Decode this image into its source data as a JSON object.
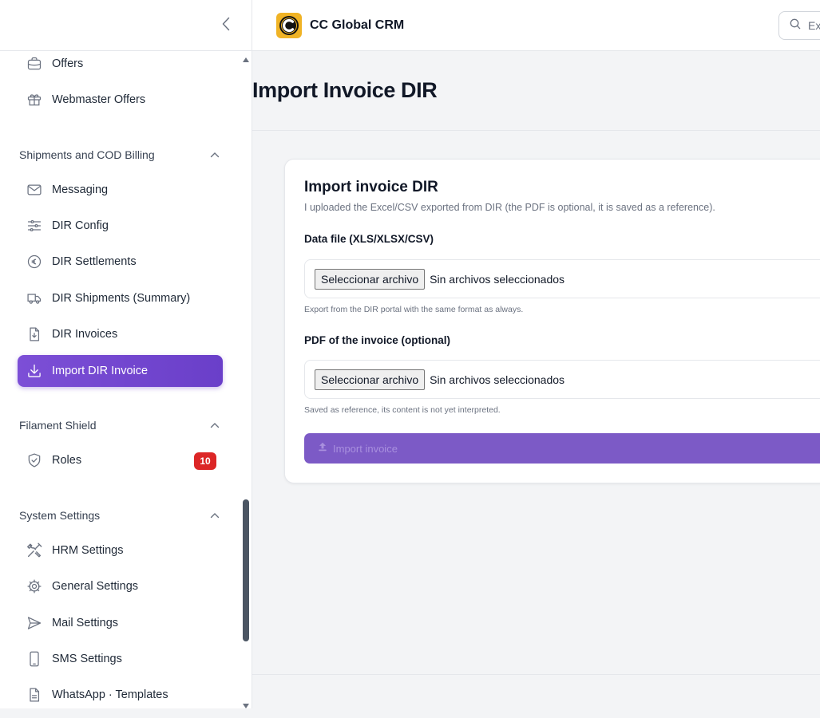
{
  "app": {
    "name": "CC Global CRM"
  },
  "search": {
    "placeholder": "Ex"
  },
  "sidebar": {
    "items_top": [
      {
        "label": "Offers",
        "icon": "briefcase-icon"
      },
      {
        "label": "Webmaster Offers",
        "icon": "gift-icon"
      }
    ],
    "groups": [
      {
        "label": "Shipments and COD Billing",
        "items": [
          {
            "label": "Messaging",
            "icon": "envelope-icon"
          },
          {
            "label": "DIR Config",
            "icon": "sliders-icon"
          },
          {
            "label": "DIR Settlements",
            "icon": "euro-icon"
          },
          {
            "label": "DIR Shipments (Summary)",
            "icon": "truck-icon"
          },
          {
            "label": "DIR Invoices",
            "icon": "document-download-icon"
          },
          {
            "label": "Import DIR Invoice",
            "icon": "download-icon",
            "active": true
          }
        ]
      },
      {
        "label": "Filament Shield",
        "items": [
          {
            "label": "Roles",
            "icon": "shield-check-icon",
            "badge": "10"
          }
        ]
      },
      {
        "label": "System Settings",
        "items": [
          {
            "label": "HRM Settings",
            "icon": "wrench-screwdriver-icon"
          },
          {
            "label": "General Settings",
            "icon": "cog-icon"
          },
          {
            "label": "Mail Settings",
            "icon": "paper-airplane-icon"
          },
          {
            "label": "SMS Settings",
            "icon": "phone-icon"
          },
          {
            "label": "WhatsApp · Templates",
            "icon": "document-text-icon"
          }
        ]
      }
    ]
  },
  "page": {
    "title": "Import Invoice DIR"
  },
  "card": {
    "title": "Import invoice DIR",
    "description": "I uploaded the Excel/CSV exported from DIR (the PDF is optional, it is saved as a reference).",
    "data_file": {
      "label": "Data file (XLS/XLSX/CSV)",
      "button": "Seleccionar archivo",
      "status": "Sin archivos seleccionados",
      "hint": "Export from the DIR portal with the same format as always."
    },
    "pdf_file": {
      "label": "PDF of the invoice (optional)",
      "button": "Seleccionar archivo",
      "status": "Sin archivos seleccionados",
      "hint": "Saved as reference, its content is not yet interpreted."
    },
    "submit": {
      "label": "Import invoice",
      "icon": "upload-icon"
    }
  },
  "colors": {
    "accent": "#6a3fc9",
    "badge": "#dc2626",
    "logo": "#f0b325"
  }
}
